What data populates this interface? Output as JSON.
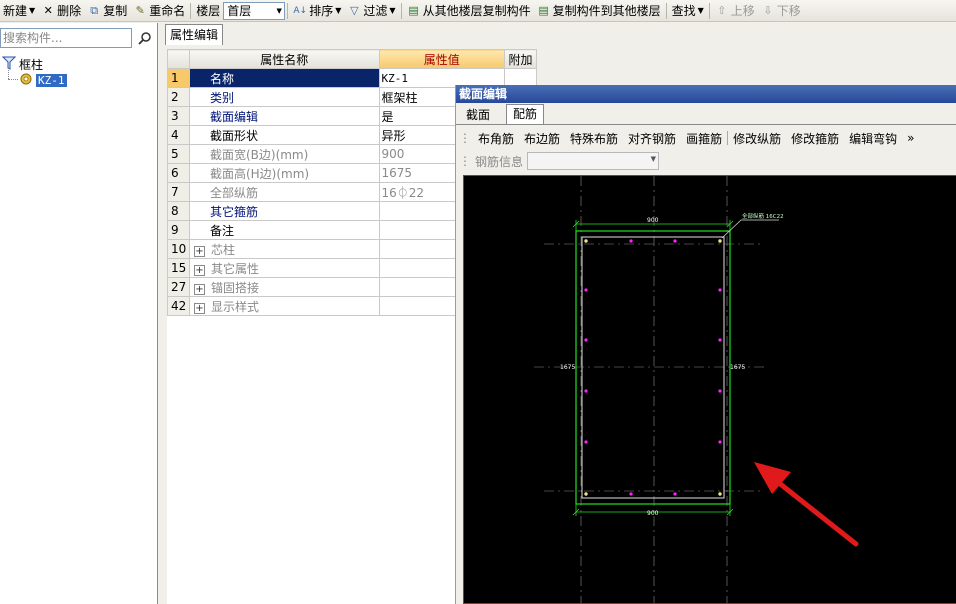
{
  "toolbar": {
    "new_label": "新建",
    "delete_label": "删除",
    "copy_label": "复制",
    "rename_label": "重命名",
    "floor_label": "楼层",
    "floor_value": "首层",
    "sort_label": "排序",
    "filter_label": "过滤",
    "copy_from_label": "从其他楼层复制构件",
    "copy_to_label": "复制构件到其他楼层",
    "find_label": "查找",
    "move_up_label": "上移",
    "move_down_label": "下移"
  },
  "left_panel": {
    "search_placeholder": "搜索构件...",
    "tree_root": "框柱",
    "tree_child": "KZ-1"
  },
  "tabs": {
    "property_edit": "属性编辑"
  },
  "property_grid": {
    "headers": {
      "name": "属性名称",
      "value": "属性值",
      "extra": "附加"
    },
    "rows": [
      {
        "num": "1",
        "name": "名称",
        "value": "KZ-1"
      },
      {
        "num": "2",
        "name": "类别",
        "value": "框架柱"
      },
      {
        "num": "3",
        "name": "截面编辑",
        "value": "是"
      },
      {
        "num": "4",
        "name": "截面形状",
        "value": "异形"
      },
      {
        "num": "5",
        "name": "截面宽(B边)(mm)",
        "value": "900"
      },
      {
        "num": "6",
        "name": "截面高(H边)(mm)",
        "value": "1675"
      },
      {
        "num": "7",
        "name": "全部纵筋",
        "value": "16⏀22"
      },
      {
        "num": "8",
        "name": "其它箍筋",
        "value": ""
      },
      {
        "num": "9",
        "name": "备注",
        "value": ""
      },
      {
        "num": "10",
        "name": "芯柱",
        "value": ""
      },
      {
        "num": "15",
        "name": "其它属性",
        "value": ""
      },
      {
        "num": "27",
        "name": "锚固搭接",
        "value": ""
      },
      {
        "num": "42",
        "name": "显示样式",
        "value": ""
      }
    ]
  },
  "section_editor": {
    "title": "截面编辑",
    "tab_section": "截面",
    "tab_rebar": "配筋",
    "tools": [
      "布角筋",
      "布边筋",
      "特殊布筋",
      "对齐钢筋",
      "画箍筋",
      "修改纵筋",
      "修改箍筋",
      "编辑弯钩"
    ],
    "more": "»",
    "rebar_info_label": "钢筋信息",
    "drawing": {
      "dim_top": "900",
      "dim_bottom": "900",
      "dim_left": "1675",
      "dim_right": "1675",
      "callout": "全部纵筋 16C22"
    },
    "colors": {
      "outline": "#20e020",
      "rebar": "#ff20ff",
      "arrow": "#e01a1a"
    }
  }
}
